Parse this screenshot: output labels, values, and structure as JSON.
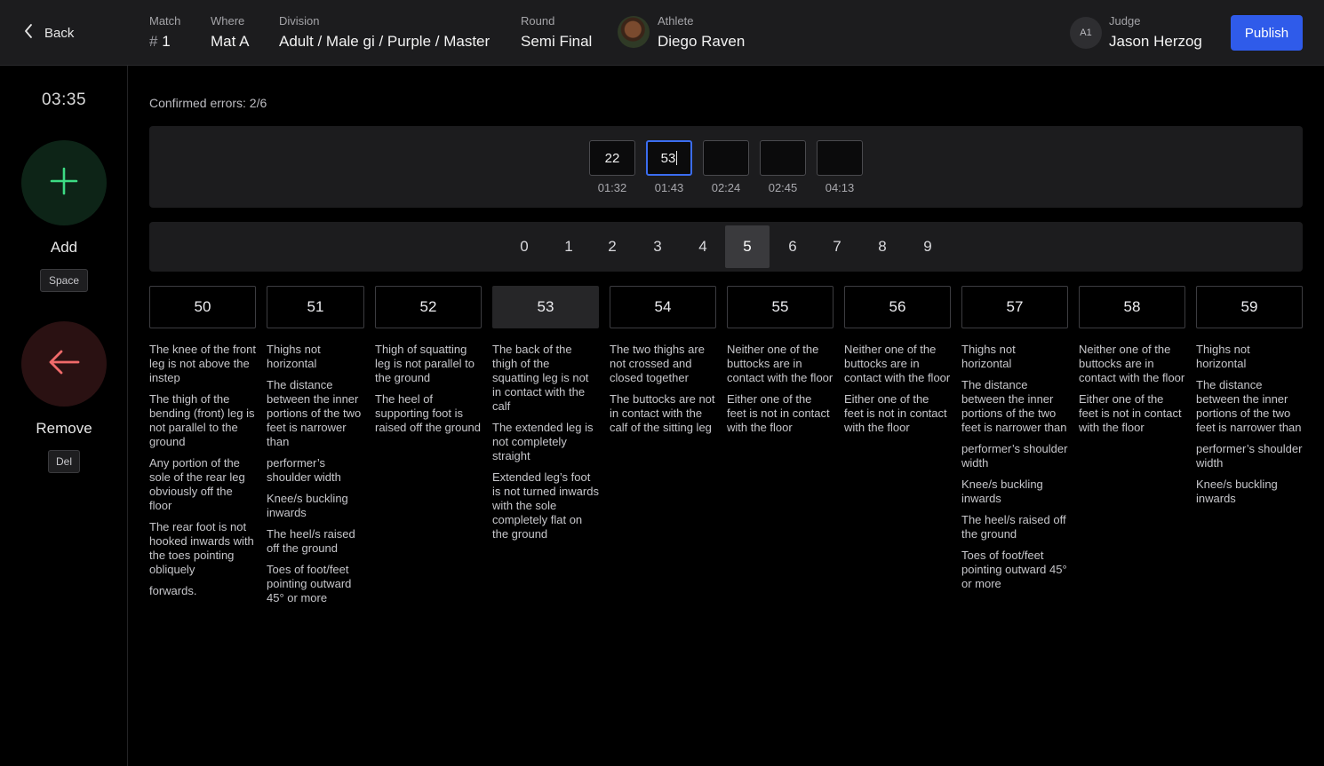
{
  "header": {
    "back_label": "Back",
    "match": {
      "label": "Match",
      "hash": "#",
      "value": "1"
    },
    "where": {
      "label": "Where",
      "value": "Mat A"
    },
    "division": {
      "label": "Division",
      "value": "Adult / Male gi / Purple / Master"
    },
    "round": {
      "label": "Round",
      "value": "Semi Final"
    },
    "athlete": {
      "label": "Athlete",
      "value": "Diego Raven"
    },
    "judge": {
      "label": "Judge",
      "value": "Jason Herzog",
      "badge": "A1"
    },
    "publish_label": "Publish"
  },
  "sidebar": {
    "timer": "03:35",
    "add_label": "Add",
    "add_key": "Space",
    "remove_label": "Remove",
    "remove_key": "Del",
    "add_color": "#3ddc84",
    "remove_color": "#f06a6a"
  },
  "main": {
    "confirmed_errors": "Confirmed errors: 2/6",
    "entries": [
      {
        "value": "22",
        "time": "01:32"
      },
      {
        "value": "53",
        "time": "01:43"
      },
      {
        "value": "",
        "time": "02:24"
      },
      {
        "value": "",
        "time": "02:45"
      },
      {
        "value": "",
        "time": "04:13"
      }
    ],
    "digits": [
      "0",
      "1",
      "2",
      "3",
      "4",
      "5",
      "6",
      "7",
      "8",
      "9"
    ],
    "selected_digit": "5",
    "codes": [
      {
        "code": "50",
        "items": [
          "The knee of the front leg is not above the instep",
          "The thigh of the bending (front) leg is not parallel to the ground",
          "Any portion of the sole of the rear leg obviously off the floor",
          "The rear foot is not hooked inwards with the toes pointing obliquely",
          "forwards."
        ]
      },
      {
        "code": "51",
        "items": [
          "Thighs not horizontal",
          "The distance between the inner portions of the two feet is narrower than",
          "performer’s shoulder width",
          "Knee/s buckling inwards",
          "The heel/s raised off the ground",
          "Toes of foot/feet pointing outward 45° or more"
        ]
      },
      {
        "code": "52",
        "items": [
          "Thigh of squatting leg is not parallel to the ground",
          "The heel of supporting foot is raised off the ground"
        ]
      },
      {
        "code": "53",
        "items": [
          "The back of the thigh of the squatting leg is not in contact with the calf",
          "The extended leg is not completely straight",
          "Extended leg’s foot is not turned inwards with the sole completely flat on the ground"
        ]
      },
      {
        "code": "54",
        "items": [
          "The two thighs are not crossed and closed together",
          "The buttocks are not in contact with the calf of the sitting leg"
        ]
      },
      {
        "code": "55",
        "items": [
          "Neither one of the buttocks are in contact with the floor",
          "Either one of the feet is not in contact with the floor"
        ]
      },
      {
        "code": "56",
        "items": [
          "Neither one of the buttocks are in contact with the floor",
          "Either one of the feet is not in contact with the floor"
        ]
      },
      {
        "code": "57",
        "items": [
          "Thighs not horizontal",
          "The distance between the inner portions of the two feet is narrower than",
          "performer’s shoulder width",
          "Knee/s buckling inwards",
          "The heel/s raised off the ground",
          "Toes of foot/feet pointing outward 45° or more"
        ]
      },
      {
        "code": "58",
        "items": [
          "Neither one of the buttocks are in contact with the floor",
          "Either one of the feet is not in contact with the floor"
        ]
      },
      {
        "code": "59",
        "items": [
          "Thighs not horizontal",
          "The distance between the inner portions of the two feet is narrower than",
          "performer’s shoulder width",
          "Knee/s buckling inwards"
        ]
      }
    ],
    "selected_code": "53",
    "accent_color": "#2f5bea"
  }
}
